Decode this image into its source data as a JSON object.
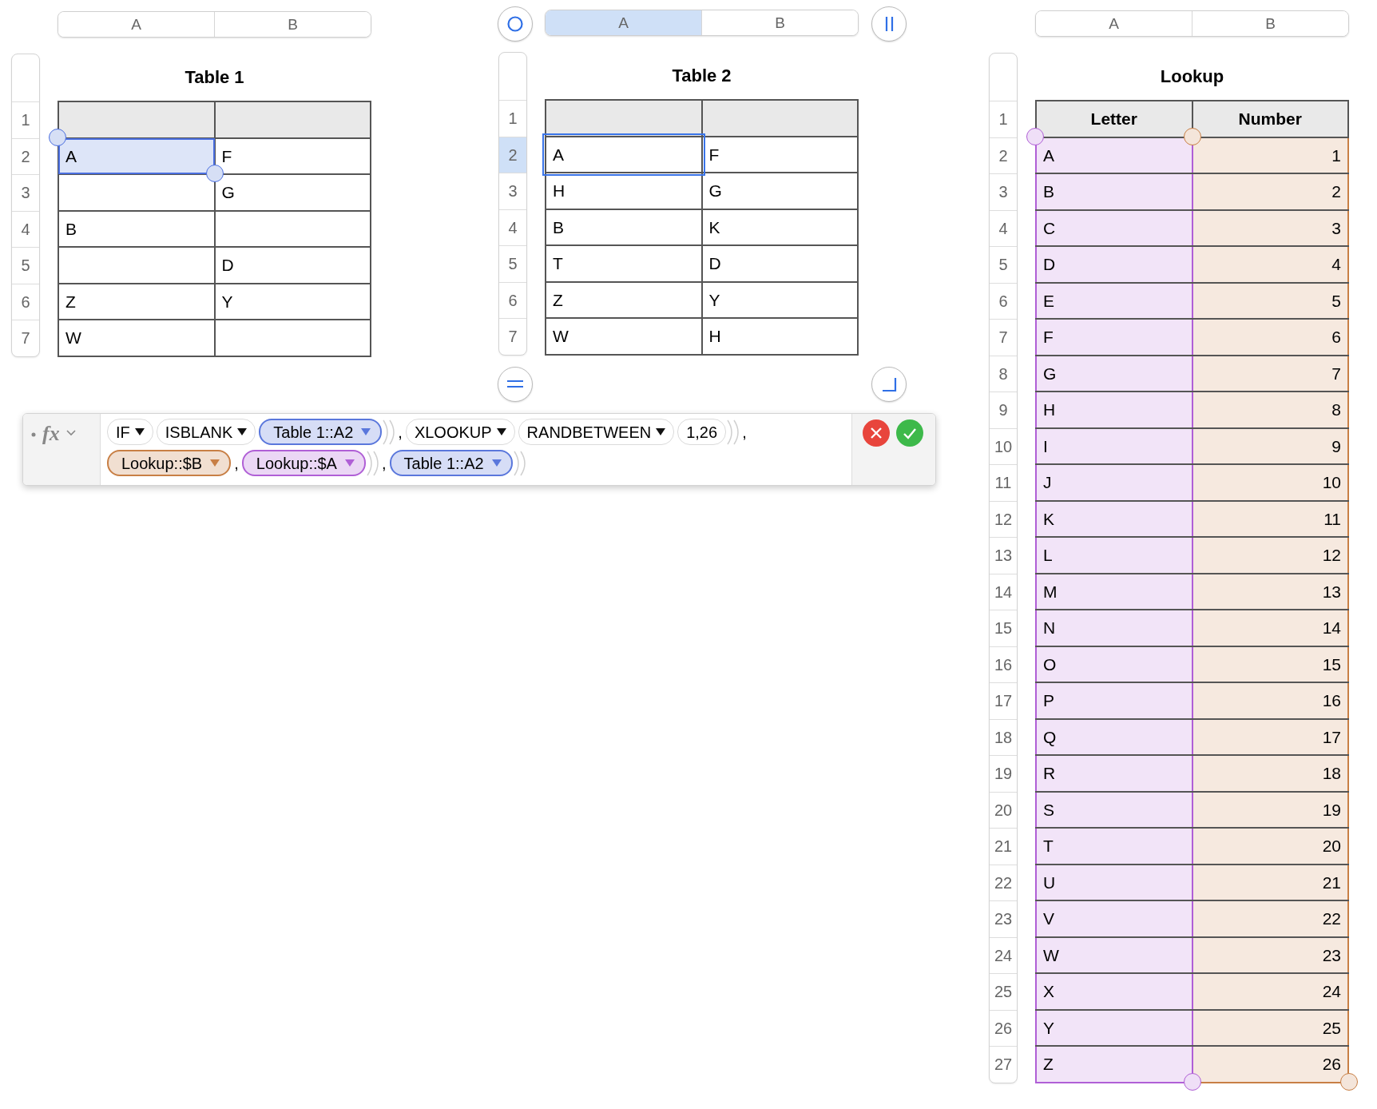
{
  "sheet": {
    "tables": [
      {
        "title": "Table 1",
        "columns": [
          {
            "label": "A",
            "selected": false
          },
          {
            "label": "B",
            "selected": false
          }
        ],
        "rows": [
          {
            "number": "1",
            "selected": false,
            "header": true,
            "cells": [
              {
                "referenced": false,
                "editing": false
              },
              {
                "referenced": false,
                "editing": false
              }
            ]
          },
          {
            "number": "2",
            "selected": false,
            "header": false,
            "cells": [
              {
                "text": "A",
                "referenced": true,
                "editing": false
              },
              {
                "text": "F",
                "referenced": false,
                "editing": false
              }
            ]
          },
          {
            "number": "3",
            "selected": false,
            "header": false,
            "cells": [
              {
                "referenced": false,
                "editing": false
              },
              {
                "text": "G",
                "referenced": false,
                "editing": false
              }
            ]
          },
          {
            "number": "4",
            "selected": false,
            "header": false,
            "cells": [
              {
                "text": "B",
                "referenced": false,
                "editing": false
              },
              {
                "referenced": false,
                "editing": false
              }
            ]
          },
          {
            "number": "5",
            "selected": false,
            "header": false,
            "cells": [
              {
                "referenced": false,
                "editing": false
              },
              {
                "text": "D",
                "referenced": false,
                "editing": false
              }
            ]
          },
          {
            "number": "6",
            "selected": false,
            "header": false,
            "cells": [
              {
                "text": "Z",
                "referenced": false,
                "editing": false
              },
              {
                "text": "Y",
                "referenced": false,
                "editing": false
              }
            ]
          },
          {
            "number": "7",
            "selected": false,
            "header": false,
            "cells": [
              {
                "text": "W",
                "referenced": false,
                "editing": false
              },
              {
                "referenced": false,
                "editing": false
              }
            ]
          }
        ]
      },
      {
        "title": "Table 2",
        "active": true,
        "columns": [
          {
            "label": "A",
            "selected": true
          },
          {
            "label": "B",
            "selected": false
          }
        ],
        "rows": [
          {
            "number": "1",
            "selected": false,
            "header": true,
            "cells": [
              {
                "referenced": false,
                "editing": false
              },
              {
                "referenced": false,
                "editing": false
              }
            ]
          },
          {
            "number": "2",
            "selected": true,
            "header": false,
            "cells": [
              {
                "text": "A",
                "referenced": false,
                "editing": true
              },
              {
                "text": "F",
                "referenced": false,
                "editing": false
              }
            ]
          },
          {
            "number": "3",
            "selected": false,
            "header": false,
            "cells": [
              {
                "text": "H",
                "referenced": false,
                "editing": false
              },
              {
                "text": "G",
                "referenced": false,
                "editing": false
              }
            ]
          },
          {
            "number": "4",
            "selected": false,
            "header": false,
            "cells": [
              {
                "text": "B",
                "referenced": false,
                "editing": false
              },
              {
                "text": "K",
                "referenced": false,
                "editing": false
              }
            ]
          },
          {
            "number": "5",
            "selected": false,
            "header": false,
            "cells": [
              {
                "text": "T",
                "referenced": false,
                "editing": false
              },
              {
                "text": "D",
                "referenced": false,
                "editing": false
              }
            ]
          },
          {
            "number": "6",
            "selected": false,
            "header": false,
            "cells": [
              {
                "text": "Z",
                "referenced": false,
                "editing": false
              },
              {
                "text": "Y",
                "referenced": false,
                "editing": false
              }
            ]
          },
          {
            "number": "7",
            "selected": false,
            "header": false,
            "cells": [
              {
                "text": "W",
                "referenced": false,
                "editing": false
              },
              {
                "text": "H",
                "referenced": false,
                "editing": false
              }
            ]
          }
        ]
      },
      {
        "title": "Lookup",
        "columns": [
          {
            "label": "A",
            "selected": false,
            "color": "#b05fd6",
            "right_aligned": false
          },
          {
            "label": "B",
            "selected": false,
            "color": "#c87f45",
            "right_aligned": true
          }
        ],
        "rows": [
          {
            "number": "1",
            "selected": false,
            "header": true,
            "cells": [
              {
                "text": "Letter"
              },
              {
                "text": "Number"
              }
            ]
          },
          {
            "number": "2",
            "selected": false,
            "header": false,
            "cells": [
              {
                "text": "A"
              },
              {
                "text": "1"
              }
            ]
          },
          {
            "number": "3",
            "selected": false,
            "header": false,
            "cells": [
              {
                "text": "B"
              },
              {
                "text": "2"
              }
            ]
          },
          {
            "number": "4",
            "selected": false,
            "header": false,
            "cells": [
              {
                "text": "C"
              },
              {
                "text": "3"
              }
            ]
          },
          {
            "number": "5",
            "selected": false,
            "header": false,
            "cells": [
              {
                "text": "D"
              },
              {
                "text": "4"
              }
            ]
          },
          {
            "number": "6",
            "selected": false,
            "header": false,
            "cells": [
              {
                "text": "E"
              },
              {
                "text": "5"
              }
            ]
          },
          {
            "number": "7",
            "selected": false,
            "header": false,
            "cells": [
              {
                "text": "F"
              },
              {
                "text": "6"
              }
            ]
          },
          {
            "number": "8",
            "selected": false,
            "header": false,
            "cells": [
              {
                "text": "G"
              },
              {
                "text": "7"
              }
            ]
          },
          {
            "number": "9",
            "selected": false,
            "header": false,
            "cells": [
              {
                "text": "H"
              },
              {
                "text": "8"
              }
            ]
          },
          {
            "number": "10",
            "selected": false,
            "header": false,
            "cells": [
              {
                "text": "I"
              },
              {
                "text": "9"
              }
            ]
          },
          {
            "number": "11",
            "selected": false,
            "header": false,
            "cells": [
              {
                "text": "J"
              },
              {
                "text": "10"
              }
            ]
          },
          {
            "number": "12",
            "selected": false,
            "header": false,
            "cells": [
              {
                "text": "K"
              },
              {
                "text": "11"
              }
            ]
          },
          {
            "number": "13",
            "selected": false,
            "header": false,
            "cells": [
              {
                "text": "L"
              },
              {
                "text": "12"
              }
            ]
          },
          {
            "number": "14",
            "selected": false,
            "header": false,
            "cells": [
              {
                "text": "M"
              },
              {
                "text": "13"
              }
            ]
          },
          {
            "number": "15",
            "selected": false,
            "header": false,
            "cells": [
              {
                "text": "N"
              },
              {
                "text": "14"
              }
            ]
          },
          {
            "number": "16",
            "selected": false,
            "header": false,
            "cells": [
              {
                "text": "O"
              },
              {
                "text": "15"
              }
            ]
          },
          {
            "number": "17",
            "selected": false,
            "header": false,
            "cells": [
              {
                "text": "P"
              },
              {
                "text": "16"
              }
            ]
          },
          {
            "number": "18",
            "selected": false,
            "header": false,
            "cells": [
              {
                "text": "Q"
              },
              {
                "text": "17"
              }
            ]
          },
          {
            "number": "19",
            "selected": false,
            "header": false,
            "cells": [
              {
                "text": "R"
              },
              {
                "text": "18"
              }
            ]
          },
          {
            "number": "20",
            "selected": false,
            "header": false,
            "cells": [
              {
                "text": "S"
              },
              {
                "text": "19"
              }
            ]
          },
          {
            "number": "21",
            "selected": false,
            "header": false,
            "cells": [
              {
                "text": "T"
              },
              {
                "text": "20"
              }
            ]
          },
          {
            "number": "22",
            "selected": false,
            "header": false,
            "cells": [
              {
                "text": "U"
              },
              {
                "text": "21"
              }
            ]
          },
          {
            "number": "23",
            "selected": false,
            "header": false,
            "cells": [
              {
                "text": "V"
              },
              {
                "text": "22"
              }
            ]
          },
          {
            "number": "24",
            "selected": false,
            "header": false,
            "cells": [
              {
                "text": "W"
              },
              {
                "text": "23"
              }
            ]
          },
          {
            "number": "25",
            "selected": false,
            "header": false,
            "cells": [
              {
                "text": "X"
              },
              {
                "text": "24"
              }
            ]
          },
          {
            "number": "26",
            "selected": false,
            "header": false,
            "cells": [
              {
                "text": "Y"
              },
              {
                "text": "25"
              }
            ]
          },
          {
            "number": "27",
            "selected": false,
            "header": false,
            "cells": [
              {
                "text": "Z"
              },
              {
                "text": "26"
              }
            ]
          }
        ]
      }
    ]
  },
  "formula_bar": {
    "label": "fx",
    "tokens": [
      {
        "kind": "function",
        "text": "IF"
      },
      {
        "kind": "function",
        "text": "ISBLANK"
      },
      {
        "kind": "reference",
        "text": "Table 1::A2",
        "color": "#5a77dc"
      },
      {
        "kind": "close"
      },
      {
        "kind": "close"
      },
      {
        "kind": "comma",
        "text": ","
      },
      {
        "kind": "function",
        "text": "XLOOKUP"
      },
      {
        "kind": "function",
        "text": "RANDBETWEEN"
      },
      {
        "kind": "number",
        "text": "1,26"
      },
      {
        "kind": "close"
      },
      {
        "kind": "close"
      },
      {
        "kind": "comma",
        "text": ","
      },
      {
        "kind": "reference",
        "text": "Lookup::$B",
        "color": "#c87f45"
      },
      {
        "kind": "comma",
        "text": ","
      },
      {
        "kind": "reference",
        "text": "Lookup::$A",
        "color": "#b05fd6"
      },
      {
        "kind": "close"
      },
      {
        "kind": "close"
      },
      {
        "kind": "comma",
        "text": ","
      },
      {
        "kind": "reference",
        "text": "Table 1::A2",
        "color": "#5a77dc"
      },
      {
        "kind": "close"
      },
      {
        "kind": "close"
      }
    ]
  }
}
